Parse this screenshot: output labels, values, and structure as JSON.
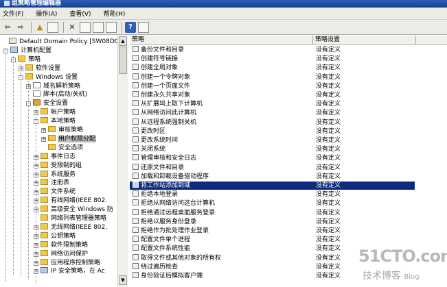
{
  "window": {
    "title": "组策略管理编辑器"
  },
  "menu": [
    "文件(F)",
    "操作(A)",
    "查看(V)",
    "帮助(H)"
  ],
  "toolbar": [
    {
      "name": "back-button",
      "glyph": "⇦",
      "cls": "arrow"
    },
    {
      "name": "forward-button",
      "glyph": "⇨",
      "cls": "arrow"
    },
    {
      "name": "sep",
      "glyph": "",
      "cls": "sep"
    },
    {
      "name": "up-folder-button",
      "glyph": "▲",
      "cls": "up"
    },
    {
      "name": "show-tree-button",
      "glyph": "",
      "cls": "page"
    },
    {
      "name": "sep",
      "glyph": "",
      "cls": "sep"
    },
    {
      "name": "delete-button",
      "glyph": "✕",
      "cls": "del"
    },
    {
      "name": "properties-button",
      "glyph": "",
      "cls": "page"
    },
    {
      "name": "refresh-button",
      "glyph": "",
      "cls": "page"
    },
    {
      "name": "export-button",
      "glyph": "",
      "cls": "page"
    },
    {
      "name": "sep",
      "glyph": "",
      "cls": "sep"
    },
    {
      "name": "help-button",
      "glyph": "?",
      "cls": "help"
    },
    {
      "name": "view-button",
      "glyph": "",
      "cls": "page"
    }
  ],
  "tree": [
    {
      "text": "Default Domain Policy [SW08DC.CONT",
      "indent": 0,
      "icon": "pol",
      "exp": ""
    },
    {
      "text": "计算机配置",
      "indent": 1,
      "icon": "comp",
      "exp": "-"
    },
    {
      "text": "策略",
      "indent": 2,
      "icon": "folder",
      "exp": "-"
    },
    {
      "text": "软件设置",
      "indent": 3,
      "icon": "folder",
      "exp": "+"
    },
    {
      "text": "Windows 设置",
      "indent": 3,
      "icon": "folder",
      "exp": "-"
    },
    {
      "text": "域名解析策略",
      "indent": 4,
      "icon": "doc",
      "exp": "+"
    },
    {
      "text": "脚本(启动/关机)",
      "indent": 4,
      "icon": "doc",
      "exp": ""
    },
    {
      "text": "安全设置",
      "indent": 4,
      "icon": "lock",
      "exp": "-"
    },
    {
      "text": "帐户策略",
      "indent": 5,
      "icon": "folder",
      "exp": "+"
    },
    {
      "text": "本地策略",
      "indent": 5,
      "icon": "folder",
      "exp": "-"
    },
    {
      "text": "审核策略",
      "indent": 6,
      "icon": "folder",
      "exp": "+"
    },
    {
      "text": "用户权限分配",
      "indent": 6,
      "icon": "folder",
      "exp": "+",
      "sel": true
    },
    {
      "text": "安全选项",
      "indent": 6,
      "icon": "folder",
      "exp": ""
    },
    {
      "text": "事件日志",
      "indent": 5,
      "icon": "folder",
      "exp": "+"
    },
    {
      "text": "受限制的组",
      "indent": 5,
      "icon": "folder",
      "exp": "+"
    },
    {
      "text": "系统服务",
      "indent": 5,
      "icon": "folder",
      "exp": "+"
    },
    {
      "text": "注册表",
      "indent": 5,
      "icon": "folder",
      "exp": "+"
    },
    {
      "text": "文件系统",
      "indent": 5,
      "icon": "folder",
      "exp": "+"
    },
    {
      "text": "有线网络(IEEE 802.",
      "indent": 5,
      "icon": "folder",
      "exp": "+"
    },
    {
      "text": "高级安全 Windows 防",
      "indent": 5,
      "icon": "folder",
      "exp": "+"
    },
    {
      "text": "网络列表管理器策略",
      "indent": 5,
      "icon": "folder",
      "exp": ""
    },
    {
      "text": "无线网络(IEEE 802.",
      "indent": 5,
      "icon": "folder",
      "exp": "+"
    },
    {
      "text": "公钥策略",
      "indent": 5,
      "icon": "folder",
      "exp": "+"
    },
    {
      "text": "软件限制策略",
      "indent": 5,
      "icon": "folder",
      "exp": "+"
    },
    {
      "text": "网络访问保护",
      "indent": 5,
      "icon": "folder",
      "exp": "+"
    },
    {
      "text": "应用程序控制策略",
      "indent": 5,
      "icon": "folder",
      "exp": "+"
    },
    {
      "text": "IP 安全策略，在 Ac",
      "indent": 5,
      "icon": "comp",
      "exp": "+"
    }
  ],
  "list": {
    "columns": [
      "策略",
      "策略设置"
    ],
    "rows": [
      {
        "policy": "备份文件和目录",
        "setting": "没有定义"
      },
      {
        "policy": "创建符号链接",
        "setting": "没有定义"
      },
      {
        "policy": "创建全局对象",
        "setting": "没有定义"
      },
      {
        "policy": "创建一个令牌对象",
        "setting": "没有定义"
      },
      {
        "policy": "创建一个页面文件",
        "setting": "没有定义"
      },
      {
        "policy": "创建永久共享对象",
        "setting": "没有定义"
      },
      {
        "policy": "从扩展坞上取下计算机",
        "setting": "没有定义"
      },
      {
        "policy": "从网络访问此计算机",
        "setting": "没有定义"
      },
      {
        "policy": "从远程系统强制关机",
        "setting": "没有定义"
      },
      {
        "policy": "更改时区",
        "setting": "没有定义"
      },
      {
        "policy": "更改系统时间",
        "setting": "没有定义"
      },
      {
        "policy": "关闭系统",
        "setting": "没有定义"
      },
      {
        "policy": "管理审核和安全日志",
        "setting": "没有定义"
      },
      {
        "policy": "还原文件和目录",
        "setting": "没有定义"
      },
      {
        "policy": "加载和卸载设备驱动程序",
        "setting": "没有定义"
      },
      {
        "policy": "将工作站添加到域",
        "setting": "没有定义",
        "sel": true
      },
      {
        "policy": "拒绝本地登录",
        "setting": "没有定义"
      },
      {
        "policy": "拒绝从网络访问这台计算机",
        "setting": "没有定义"
      },
      {
        "policy": "拒绝通过远程桌面服务登录",
        "setting": "没有定义"
      },
      {
        "policy": "拒绝以服务身份登录",
        "setting": "没有定义"
      },
      {
        "policy": "拒绝作为批处理作业登录",
        "setting": "没有定义"
      },
      {
        "policy": "配置文件单个进程",
        "setting": "没有定义"
      },
      {
        "policy": "配置文件系统性能",
        "setting": "没有定义"
      },
      {
        "policy": "取得文件或其他对象的所有权",
        "setting": "没有定义"
      },
      {
        "policy": "绕过遍历检查",
        "setting": "没有定义"
      },
      {
        "policy": "身份验证后模拟客户端",
        "setting": "没有定义"
      }
    ]
  },
  "watermark": {
    "brand": "51CTO.com",
    "sub": "技术博客",
    "blog": "Blog"
  }
}
